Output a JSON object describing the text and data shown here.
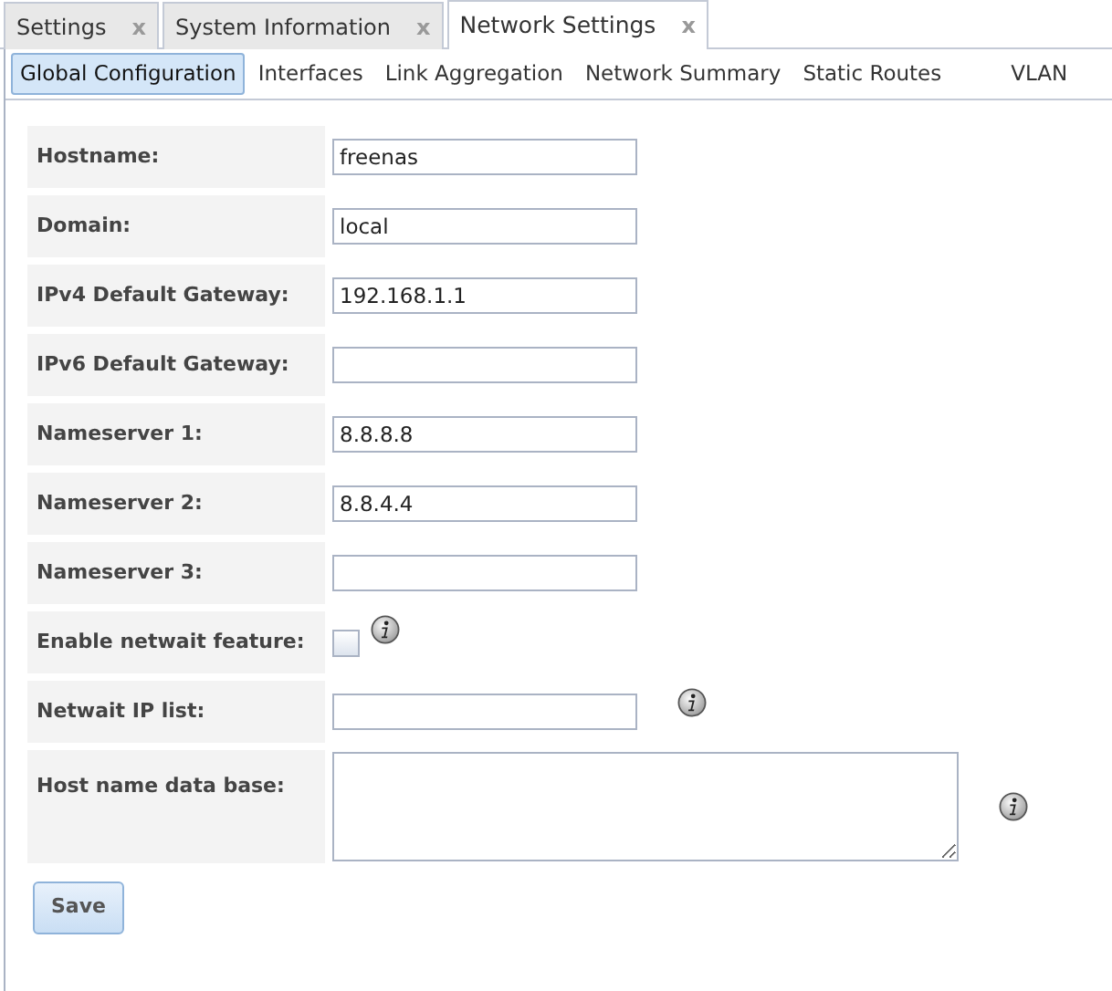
{
  "tabs": [
    {
      "label": "Settings",
      "close": "x",
      "selected": false
    },
    {
      "label": "System Information",
      "close": "x",
      "selected": false
    },
    {
      "label": "Network Settings",
      "close": "x",
      "selected": true
    }
  ],
  "subtabs": [
    {
      "label": "Global Configuration",
      "selected": true
    },
    {
      "label": "Interfaces",
      "selected": false
    },
    {
      "label": "Link Aggregation",
      "selected": false
    },
    {
      "label": "Network Summary",
      "selected": false
    },
    {
      "label": "Static Routes",
      "selected": false
    },
    {
      "label": "VLAN",
      "selected": false
    }
  ],
  "fields": [
    {
      "label": "Hostname:",
      "kind": "text",
      "value": "freenas",
      "help": false
    },
    {
      "label": "Domain:",
      "kind": "text",
      "value": "local",
      "help": false
    },
    {
      "label": "IPv4 Default Gateway:",
      "kind": "text",
      "value": "192.168.1.1",
      "help": false
    },
    {
      "label": "IPv6 Default Gateway:",
      "kind": "text",
      "help": false
    },
    {
      "label": "Nameserver 1:",
      "kind": "text",
      "value": "8.8.8.8",
      "help": false
    },
    {
      "label": "Nameserver 2:",
      "kind": "text",
      "value": "8.8.4.4",
      "help": false
    },
    {
      "label": "Nameserver 3:",
      "kind": "text",
      "help": false
    },
    {
      "label": "Enable netwait feature:",
      "kind": "checkbox",
      "checked": false,
      "help": true
    },
    {
      "label": "Netwait IP list:",
      "kind": "text",
      "help": true
    },
    {
      "label": "Host name data base:",
      "kind": "textarea",
      "help": true
    }
  ],
  "save_button": "Save"
}
